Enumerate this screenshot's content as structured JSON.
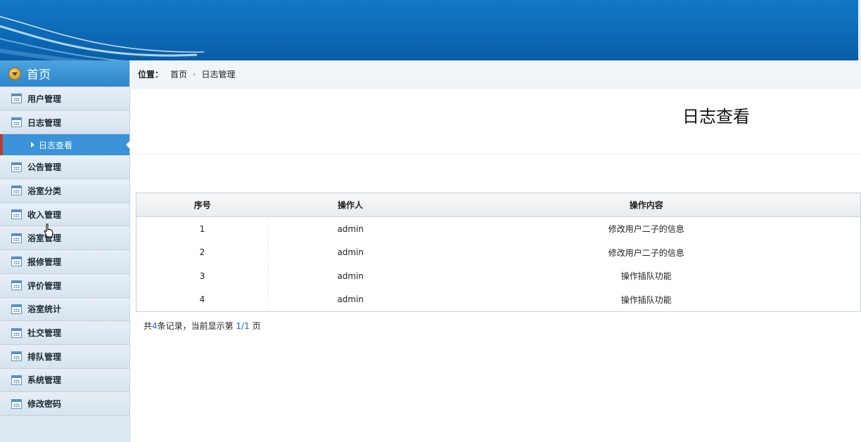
{
  "sidebar": {
    "home_label": "首页",
    "items": [
      {
        "label": "用户管理"
      },
      {
        "label": "日志管理"
      },
      {
        "label": "公告管理"
      },
      {
        "label": "浴室分类"
      },
      {
        "label": "收入管理"
      },
      {
        "label": "浴室管理"
      },
      {
        "label": "报修管理"
      },
      {
        "label": "评价管理"
      },
      {
        "label": "浴室统计"
      },
      {
        "label": "社交管理"
      },
      {
        "label": "排队管理"
      },
      {
        "label": "系统管理"
      },
      {
        "label": "修改密码"
      }
    ],
    "active_sub": {
      "label": "日志查看"
    }
  },
  "breadcrumb": {
    "label": "位置：",
    "home": "首页",
    "current": "日志管理"
  },
  "page_title": "日志查看",
  "table": {
    "headers": [
      "序号",
      "操作人",
      "操作内容"
    ],
    "rows": [
      [
        "1",
        "admin",
        "修改用户二子的信息"
      ],
      [
        "2",
        "admin",
        "修改用户二子的信息"
      ],
      [
        "3",
        "admin",
        "操作插队功能"
      ],
      [
        "4",
        "admin",
        "操作插队功能"
      ]
    ]
  },
  "pager": {
    "prefix": "共",
    "total": "4",
    "mid": "条记录，当前显示第",
    "page": "1/1",
    "suffix": "页"
  },
  "colors": {
    "header_blue": "#0d6ab6",
    "active_blue": "#3a93d8",
    "active_marker": "#c0392b"
  }
}
